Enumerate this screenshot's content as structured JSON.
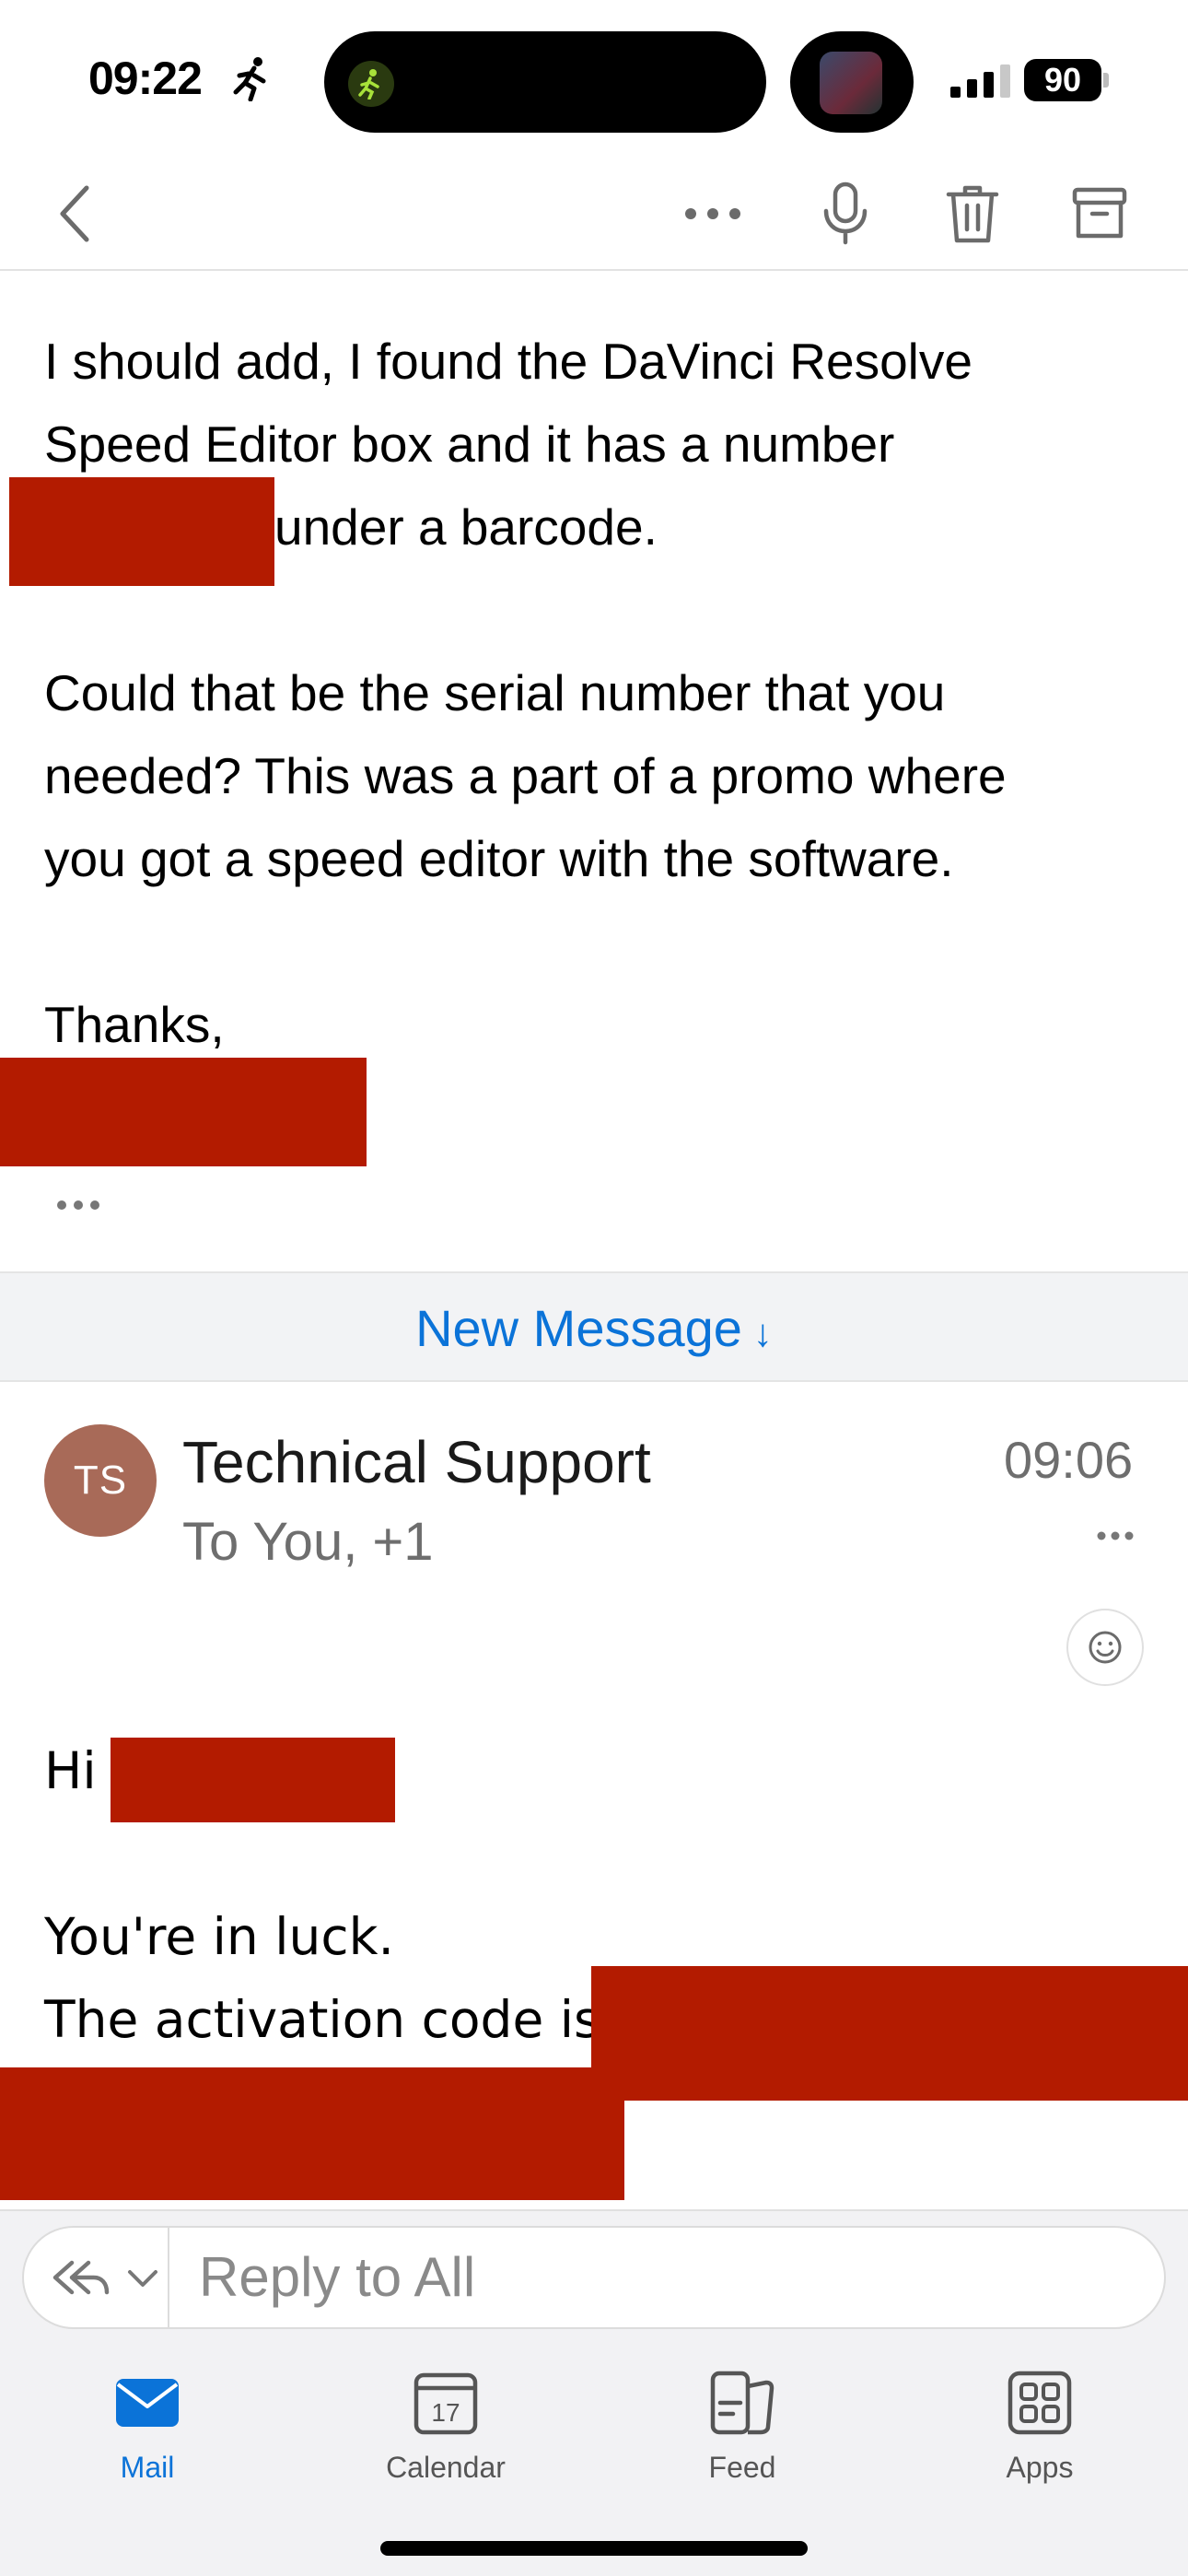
{
  "status_bar": {
    "time": "09:22",
    "battery_level": "90"
  },
  "toolbar": {
    "icons": [
      "back-chevron-icon",
      "more-icon",
      "microphone-icon",
      "trash-icon",
      "archive-icon"
    ]
  },
  "previous_message": {
    "line1": "I should add, I found the DaVinci Resolve",
    "line2": "Speed Editor box and it has a number",
    "line3_after_redaction": "under a barcode.",
    "para2_line1": "Could that be the serial number that you",
    "para2_line2": "needed? This was a part of a promo where",
    "para2_line3": "you got a speed editor with the software.",
    "closing": "Thanks,"
  },
  "new_message_bar": {
    "label": "New Message",
    "arrow": "↓"
  },
  "message": {
    "avatar_initials": "TS",
    "avatar_color": "#a86a58",
    "sender": "Technical Support",
    "recipients": "To You, +1",
    "time": "09:06",
    "greeting": "Hi",
    "line1": "You're in luck.",
    "line2": "The activation code is"
  },
  "reply": {
    "placeholder": "Reply to All"
  },
  "tabs": [
    {
      "label": "Mail",
      "icon": "mail-icon",
      "active": true
    },
    {
      "label": "Calendar",
      "icon": "calendar-icon",
      "day": "17",
      "active": false
    },
    {
      "label": "Feed",
      "icon": "feed-icon",
      "active": false
    },
    {
      "label": "Apps",
      "icon": "apps-icon",
      "active": false
    }
  ],
  "colors": {
    "accent": "#0b73d8",
    "redaction": "#b31b00"
  }
}
